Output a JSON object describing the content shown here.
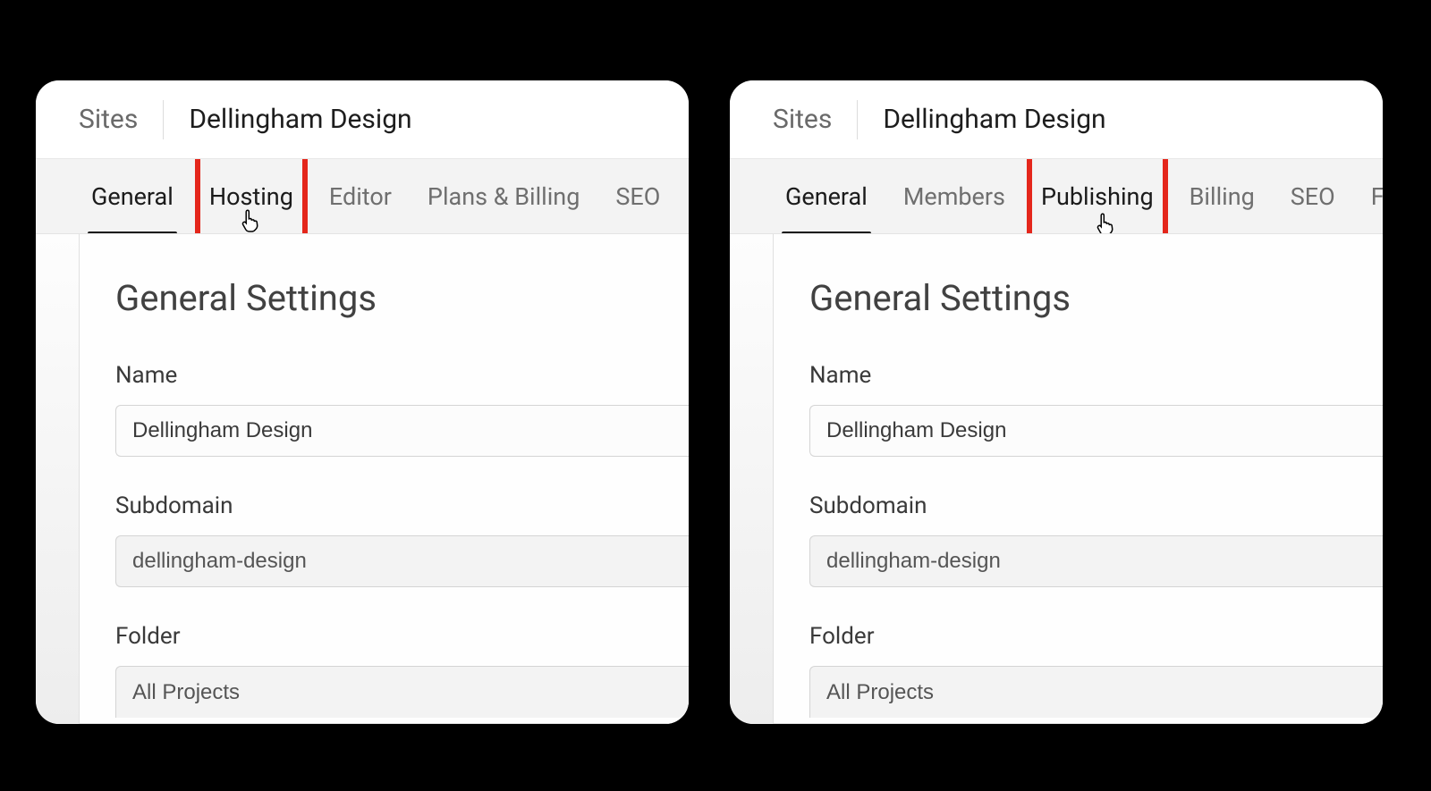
{
  "colors": {
    "highlight_box": "#e4261b",
    "tab_active_underline": "#1b1b1b"
  },
  "left": {
    "breadcrumb_root": "Sites",
    "breadcrumb_current": "Dellingham Design",
    "tabs": {
      "general": {
        "label": "General",
        "active": true
      },
      "hosting": {
        "label": "Hosting",
        "highlighted": true
      },
      "editor": {
        "label": "Editor"
      },
      "plans_billing": {
        "label": "Plans & Billing"
      },
      "seo": {
        "label": "SEO"
      }
    },
    "settings": {
      "heading": "General Settings",
      "name_label": "Name",
      "name_value": "Dellingham Design",
      "subdomain_label": "Subdomain",
      "subdomain_value": "dellingham-design",
      "folder_label": "Folder",
      "folder_value": "All Projects"
    }
  },
  "right": {
    "breadcrumb_root": "Sites",
    "breadcrumb_current": "Dellingham Design",
    "tabs": {
      "general": {
        "label": "General",
        "active": true
      },
      "members": {
        "label": "Members"
      },
      "publishing": {
        "label": "Publishing",
        "highlighted": true
      },
      "billing": {
        "label": "Billing"
      },
      "seo": {
        "label": "SEO"
      },
      "fonts": {
        "label": "Fonts"
      }
    },
    "settings": {
      "heading": "General Settings",
      "name_label": "Name",
      "name_value": "Dellingham Design",
      "subdomain_label": "Subdomain",
      "subdomain_value": "dellingham-design",
      "folder_label": "Folder",
      "folder_value": "All Projects"
    }
  }
}
